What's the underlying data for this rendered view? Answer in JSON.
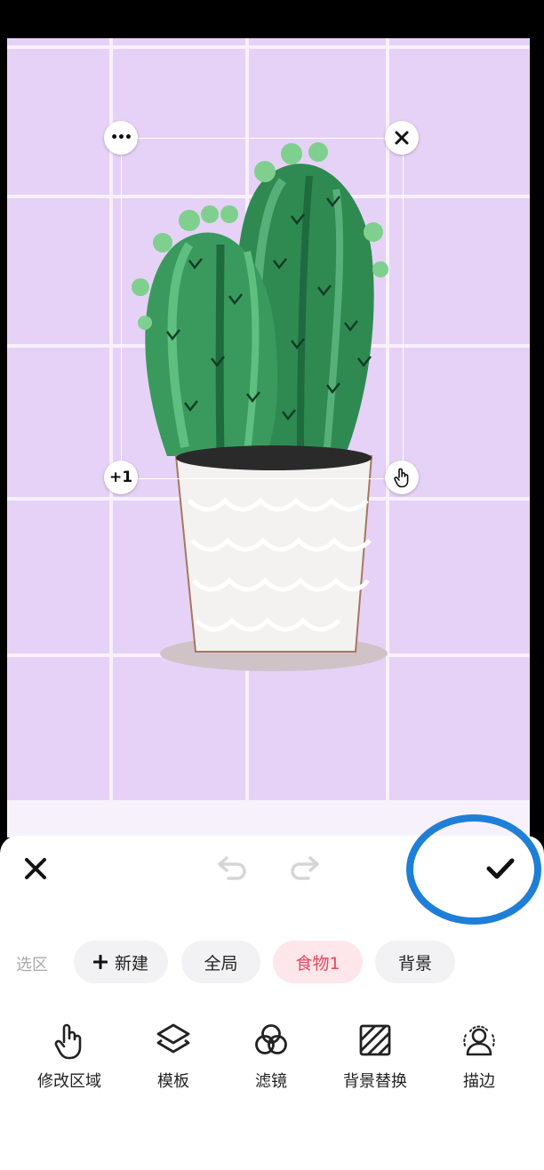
{
  "selection": {
    "more_label": "•••",
    "add_label": "+1"
  },
  "toolbar": {
    "label": "选区"
  },
  "chips": [
    {
      "label": "新建"
    },
    {
      "label": "全局"
    },
    {
      "label": "食物1"
    },
    {
      "label": "背景"
    }
  ],
  "tools": [
    {
      "label": "修改区域",
      "icon": "hand-pointer-icon"
    },
    {
      "label": "模板",
      "icon": "layers-icon"
    },
    {
      "label": "滤镜",
      "icon": "filter-circles-icon"
    },
    {
      "label": "背景替换",
      "icon": "background-replace-icon"
    },
    {
      "label": "描边",
      "icon": "outline-person-icon"
    }
  ],
  "colors": {
    "accent": "#e8485f",
    "highlight_ring": "#1f7fd6",
    "canvas_bg": "#e6d2f6"
  }
}
